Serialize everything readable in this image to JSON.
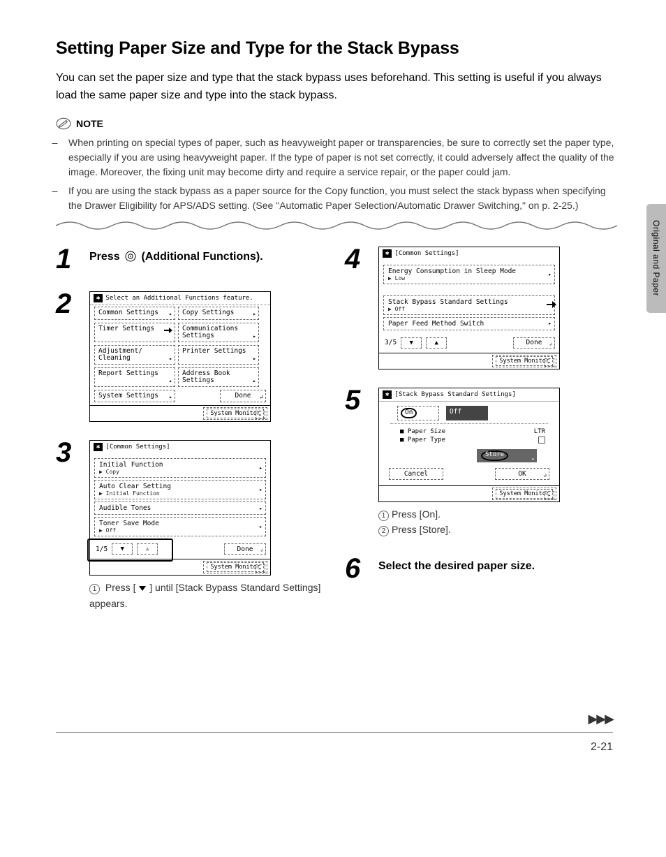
{
  "heading": "Setting Paper Size and Type for the Stack Bypass",
  "intro": "You can set the paper size and type that the stack bypass uses beforehand. This setting is useful if you always load the same paper size and type into the stack bypass.",
  "note_label": "NOTE",
  "notes": [
    "When printing on special types of paper, such as heavyweight paper or transparencies, be sure to correctly set the paper type, especially if you are using heavyweight paper. If the type of paper is not set correctly, it could adversely affect the quality of the image. Moreover, the fixing unit may become dirty and require a service repair, or the paper could jam.",
    "If you are using the stack bypass as a paper source for the Copy function, you must select the stack bypass when specifying the Drawer Eligibility for APS/ADS setting. (See \"Automatic Paper Selection/Automatic Drawer Switching,\" on p. 2-25.)"
  ],
  "side_tab": "Original and Paper",
  "page_number": "2-21",
  "steps": {
    "s1": {
      "num": "1",
      "title_a": "Press ",
      "title_b": " (Additional Functions)."
    },
    "s2": {
      "num": "2"
    },
    "s3": {
      "num": "3",
      "sub1_a": "Press [",
      "sub1_b": "] until [Stack Bypass Standard Settings] appears."
    },
    "s4": {
      "num": "4"
    },
    "s5": {
      "num": "5",
      "sub1": "Press [On].",
      "sub2": "Press [Store]."
    },
    "s6": {
      "num": "6",
      "title": "Select the desired paper size."
    }
  },
  "lcd2": {
    "header": "Select an Additional Functions feature.",
    "items": [
      "Common Settings",
      "Copy Settings",
      "Timer Settings",
      "Communications Settings",
      "Adjustment/ Cleaning",
      "Printer Settings",
      "Report Settings",
      "Address Book Settings",
      "System Settings"
    ],
    "done": "Done",
    "sysmon": "System Monitor"
  },
  "lcd3": {
    "title": "[Common Settings]",
    "rows": [
      {
        "t": "Initial Function",
        "s": "▶ Copy"
      },
      {
        "t": "Auto Clear Setting",
        "s": "▶ Initial Function"
      },
      {
        "t": "Audible Tones",
        "s": ""
      },
      {
        "t": "Toner Save Mode",
        "s": "▶ Off"
      }
    ],
    "page": "1/5",
    "done": "Done",
    "sysmon": "System Monitor"
  },
  "lcd4": {
    "title": "[Common Settings]",
    "rows": [
      {
        "t": "Energy Consumption in Sleep Mode",
        "s": "▶ Low",
        "hand": false
      },
      {
        "t": "Stack Bypass Standard Settings",
        "s": "▶ Off",
        "hand": true
      },
      {
        "t": "Paper Feed Method Switch",
        "s": "",
        "hand": false
      }
    ],
    "page": "3/5",
    "done": "Done",
    "sysmon": "System Monitor"
  },
  "lcd5": {
    "title": "[Stack Bypass Standard Settings]",
    "on": "On",
    "off": "Off",
    "paper_size_lbl": "■ Paper Size",
    "paper_size_val": "LTR",
    "paper_type_lbl": "■ Paper Type",
    "store": "Store",
    "cancel": "Cancel",
    "ok": "OK",
    "sysmon": "System Monitor"
  }
}
